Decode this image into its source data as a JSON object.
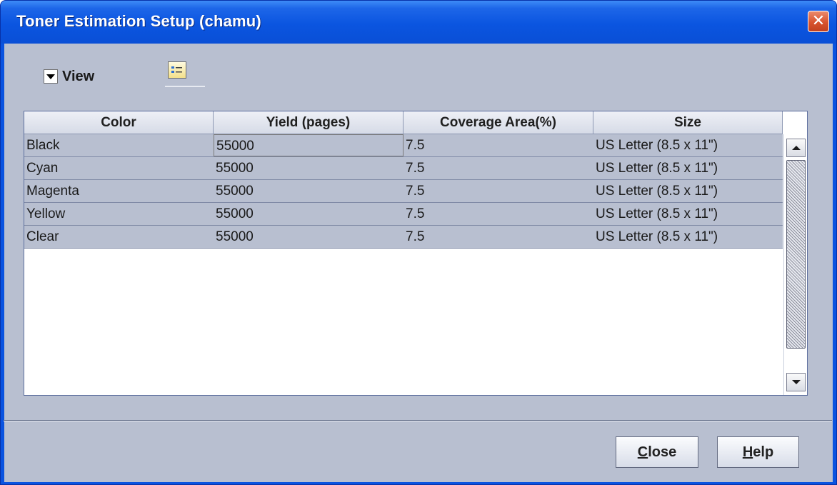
{
  "window": {
    "title": "Toner Estimation Setup (chamu)",
    "close_glyph": "✕"
  },
  "toolbar": {
    "view_label": "View",
    "view_icon": "chevron-down-icon",
    "detail_icon": "details-view-icon"
  },
  "table": {
    "columns": [
      "Color",
      "Yield (pages)",
      "Coverage Area(%)",
      "Size"
    ],
    "rows": [
      [
        "Black",
        "55000",
        "7.5",
        "US Letter (8.5 x 11\")"
      ],
      [
        "Cyan",
        "55000",
        "7.5",
        "US Letter (8.5 x 11\")"
      ],
      [
        "Magenta",
        "55000",
        "7.5",
        "US Letter (8.5 x 11\")"
      ],
      [
        "Yellow",
        "55000",
        "7.5",
        "US Letter (8.5 x 11\")"
      ],
      [
        "Clear",
        "55000",
        "7.5",
        "US Letter (8.5 x 11\")"
      ]
    ]
  },
  "buttons": {
    "close_mnemonic": "C",
    "close_rest": "lose",
    "help_mnemonic": "H",
    "help_rest": "elp"
  },
  "colors": {
    "title_bar": "#0b55e0",
    "client_bg": "#b8bfd0",
    "table_bg": "#ffffff",
    "close_button": "#d8532e"
  }
}
